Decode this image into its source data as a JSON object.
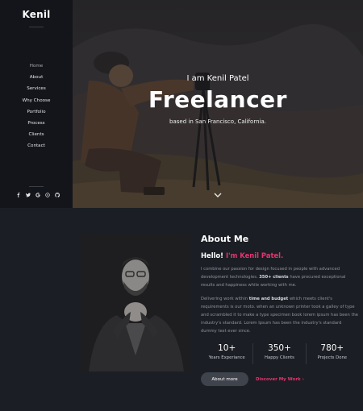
{
  "sidebar": {
    "brand": "Kenil",
    "nav": [
      {
        "label": "Home",
        "active": true
      },
      {
        "label": "About"
      },
      {
        "label": "Services"
      },
      {
        "label": "Why Choose"
      },
      {
        "label": "Portfolio"
      },
      {
        "label": "Process"
      },
      {
        "label": "Clients"
      },
      {
        "label": "Contact"
      }
    ],
    "socials": [
      "facebook-icon",
      "twitter-icon",
      "google-icon",
      "dribbble-icon",
      "github-icon"
    ]
  },
  "hero": {
    "intro": "I am Kenil Patel",
    "title": "Freelancer",
    "location": "based in San Francisco, California.",
    "scroll_icon": "chevron-down-icon"
  },
  "about": {
    "title": "About Me",
    "hello": "Hello!",
    "name": "I'm Kenil Patel.",
    "p1_before": "I combine our passion for design focused in people with advanced development technologies.",
    "p1_bold": "350+ clients",
    "p1_after": "have procured exceptional results and happiness while working with me.",
    "p2_before": "Delivering work within",
    "p2_bold": "time and budget",
    "p2_after": "which meets client's requirements is our moto. when an unknown printer took a galley of type and scrambled it to make a type specimen book lorem ipsum has been the industry's standard. Lorem Ipsum has been the industry's standard dummy text ever since.",
    "stats": [
      {
        "value": "10+",
        "label": "Years Experiance"
      },
      {
        "value": "350+",
        "label": "Happy Clients"
      },
      {
        "value": "780+",
        "label": "Projects Done"
      }
    ],
    "btn_more": "About more",
    "link_work": "Discover My Work",
    "accent": "#e73370"
  }
}
